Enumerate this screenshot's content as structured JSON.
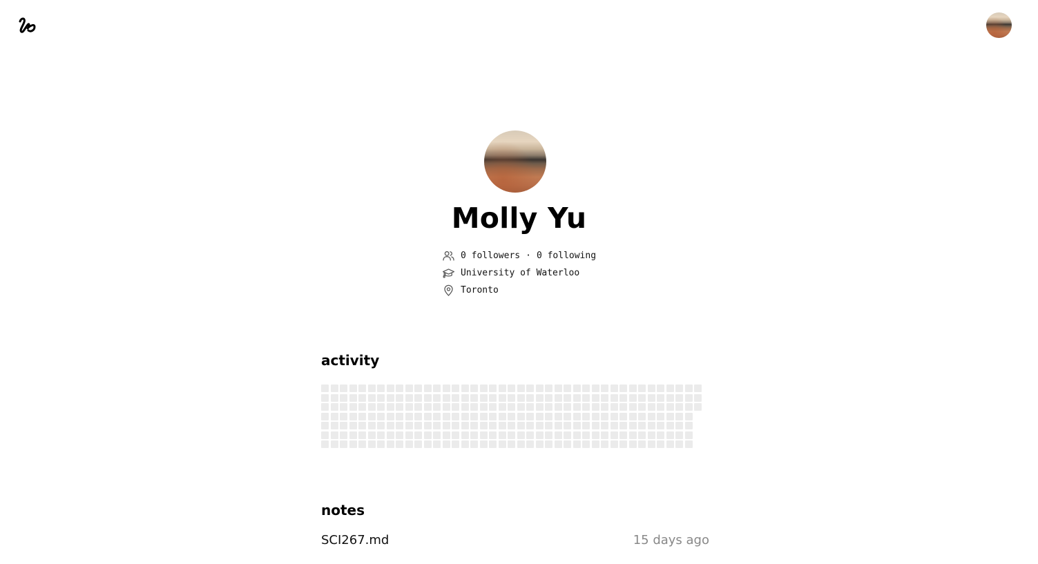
{
  "app": {
    "logo_icon": "squiggle-logo-icon"
  },
  "header": {
    "avatar_icon": "user-avatar-icon"
  },
  "profile": {
    "name": "Molly Yu",
    "followers_count": "0",
    "followers_label": "followers",
    "separator": "·",
    "following_count": "0",
    "following_label": "following",
    "school": "University of Waterloo",
    "location": "Toronto",
    "icons": {
      "people": "people-icon",
      "school": "graduation-cap-icon",
      "location": "map-pin-icon"
    }
  },
  "activity": {
    "title": "activity",
    "weeks": 41,
    "last_week_days": 3,
    "cell_color": "#ebebeb"
  },
  "notes": {
    "title": "notes",
    "items": [
      {
        "name": "SCI267.md",
        "time": "15 days ago"
      }
    ]
  }
}
